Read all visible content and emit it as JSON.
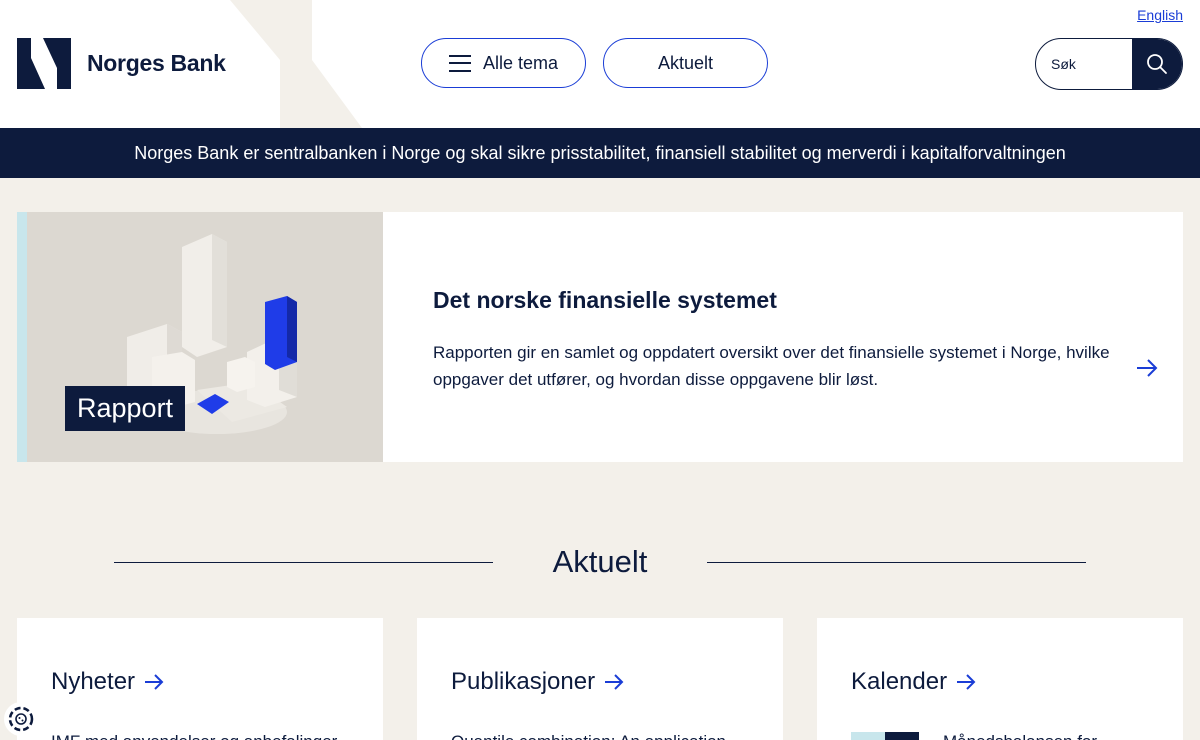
{
  "header": {
    "language_link": "English",
    "logo_text": "Norges Bank",
    "menu_button": "Alle tema",
    "news_button": "Aktuelt",
    "search_placeholder": "Søk"
  },
  "tagline": "Norges Bank er sentralbanken i Norge og skal sikre prisstabilitet, finansiell stabilitet og merverdi i kapitalforvaltningen",
  "feature": {
    "badge": "Rapport",
    "title": "Det norske finansielle systemet",
    "text": "Rapporten gir en samlet og oppdatert oversikt over det finansielle systemet i Norge, hvilke oppgaver det utfører, og hvordan disse oppgavene blir løst."
  },
  "section": {
    "title": "Aktuelt"
  },
  "cards": [
    {
      "title": "Nyheter",
      "snippet": "IMF med anvendelser og anbefalinger"
    },
    {
      "title": "Publikasjoner",
      "snippet": "Quantile combination: An application"
    },
    {
      "title": "Kalender",
      "snippet": "Månedsbalansen for"
    }
  ],
  "colors": {
    "navy": "#0d1b3d",
    "accent_blue": "#1a3dd6",
    "page_bg": "#f3f0ea",
    "light_teal": "#c8e6ec"
  }
}
